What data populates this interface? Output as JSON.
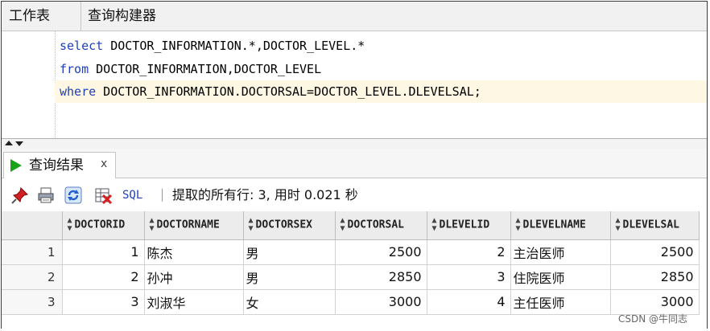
{
  "top_tabs": [
    "工作表",
    "查询构建器"
  ],
  "editor": {
    "lines": [
      {
        "keyword": "select",
        "rest": " DOCTOR_INFORMATION.*,DOCTOR_LEVEL.*"
      },
      {
        "keyword": "from",
        "rest": " DOCTOR_INFORMATION,DOCTOR_LEVEL"
      },
      {
        "keyword": "where",
        "rest": " DOCTOR_INFORMATION.DOCTORSAL=DOCTOR_LEVEL.DLEVELSAL;"
      }
    ]
  },
  "results_tab": {
    "label": "查询结果",
    "close": "x"
  },
  "toolbar": {
    "icons": [
      "pin-icon",
      "print-icon",
      "refresh-icon",
      "clear-icon"
    ],
    "sql_label": "SQL",
    "status": "提取的所有行: 3, 用时 0.021 秒"
  },
  "grid": {
    "columns": [
      "DOCTORID",
      "DOCTORNAME",
      "DOCTORSEX",
      "DOCTORSAL",
      "DLEVELID",
      "DLEVELNAME",
      "DLEVELSAL"
    ],
    "rows": [
      {
        "n": "1",
        "cells": [
          "1",
          "陈杰",
          "男",
          "2500",
          "2",
          "主治医师",
          "2500"
        ]
      },
      {
        "n": "2",
        "cells": [
          "2",
          "孙冲",
          "男",
          "2850",
          "3",
          "住院医师",
          "2850"
        ]
      },
      {
        "n": "3",
        "cells": [
          "3",
          "刘淑华",
          "女",
          "3000",
          "4",
          "主任医师",
          "3000"
        ]
      }
    ]
  },
  "watermark": "CSDN @牛同志",
  "colors": {
    "keyword": "#1f3fb8",
    "highlight_line": "#fdf7e3",
    "run_icon": "#1aa31a"
  }
}
